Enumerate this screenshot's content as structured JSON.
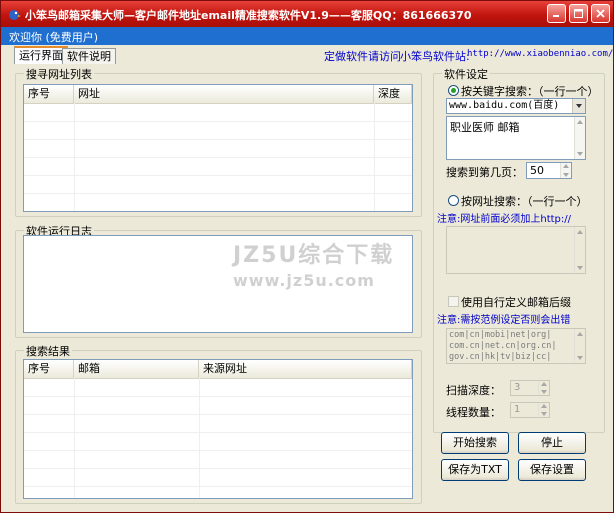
{
  "window": {
    "title": "小笨鸟邮箱采集大师—客户邮件地址email精准搜索软件V1.9——客服QQ：861666370"
  },
  "welcome": {
    "text": "欢迎你 (免费用户)"
  },
  "tabs": [
    {
      "label": "运行界面"
    },
    {
      "label": "软件说明"
    }
  ],
  "header_links": {
    "custom_software": "定做软件请访问",
    "site_label": "小笨鸟软件站:",
    "site_url": "http://www.xiaobenniao.com/"
  },
  "url_list": {
    "title": "搜寻网址列表",
    "columns": [
      "序号",
      "网址",
      "深度"
    ],
    "rows": []
  },
  "log": {
    "title": "软件运行日志"
  },
  "results": {
    "title": "搜索结果",
    "columns": [
      "序号",
      "邮箱",
      "来源网址"
    ],
    "rows": []
  },
  "settings": {
    "title": "软件设定",
    "keyword_mode_label": "按关键字搜索：（一行一个）",
    "engine_value": "www.baidu.com(百度)",
    "keywords_value": "职业医师 邮箱",
    "pages_label": "搜索到第几页：",
    "pages_value": "50",
    "url_mode_label": "按网址搜索：（一行一个）",
    "url_note": "注意:网址前面必须加上http://",
    "custom_suffix_label": "使用自行定义邮箱后缀",
    "suffix_note": "注意:需按范例设定否则会出错",
    "suffix_lines": [
      "com|cn|mobi|net|org|",
      "com.cn|net.cn|org.cn|",
      "gov.cn|hk|tv|biz|cc|"
    ],
    "scan_depth_label": "扫描深度：",
    "scan_depth_value": "3",
    "threads_label": "线程数量：",
    "threads_value": "1"
  },
  "buttons": {
    "start": "开始搜索",
    "stop": "停止",
    "save_txt": "保存为TXT",
    "save_settings": "保存设置"
  },
  "watermark": {
    "line1": "JZ5U综合下载",
    "line2": "www.jz5u.com"
  },
  "colors": {
    "titlebar": "#c0140e",
    "welcome_bar": "#1f6fd0",
    "link": "#0000cc"
  }
}
